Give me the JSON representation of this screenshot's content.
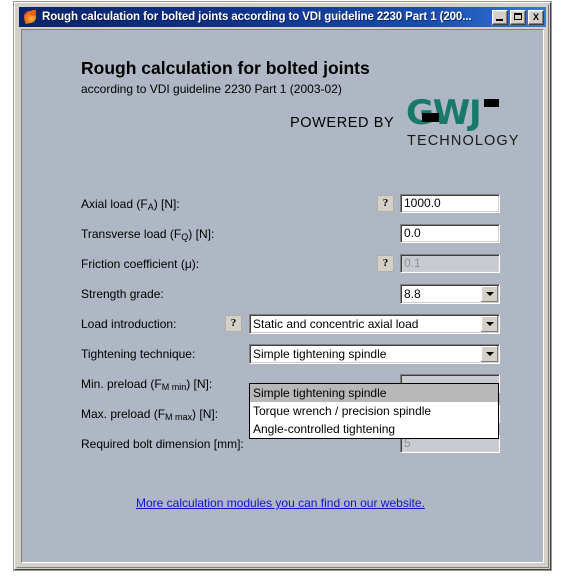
{
  "window": {
    "title": "Rough calculation for bolted joints according to VDI guideline 2230 Part 1 (200...",
    "icon": "firefox-icon",
    "minimize_label": "_",
    "maximize_label": "□",
    "close_label": "X"
  },
  "header": {
    "heading": "Rough calculation for bolted joints",
    "subheading": "according to VDI guideline 2230 Part 1 (2003-02)",
    "powered_by": "POWERED BY",
    "logo_mark": "GWJ",
    "logo_word": "TECHNOLOGY",
    "logo_color": "#18796b"
  },
  "form": {
    "help_glyph": "?",
    "rows": [
      {
        "label_main": "Axial load (F",
        "label_sub": "A",
        "label_tail": ") [N]:",
        "has_help": true,
        "control": "text",
        "value": "1000.0",
        "disabled": false
      },
      {
        "label_main": "Transverse load (F",
        "label_sub": "Q",
        "label_tail": ") [N]:",
        "has_help": false,
        "control": "text",
        "value": "0.0",
        "disabled": false
      },
      {
        "label_main": "Friction coefficient (μ):",
        "label_sub": "",
        "label_tail": "",
        "has_help": true,
        "control": "text",
        "value": "0.1",
        "disabled": true
      },
      {
        "label_main": "Strength grade:",
        "label_sub": "",
        "label_tail": "",
        "has_help": false,
        "control": "combo-short",
        "value": "8.8",
        "disabled": false
      },
      {
        "label_main": "Load introduction:",
        "label_sub": "",
        "label_tail": "",
        "has_help": true,
        "control": "combo-long",
        "value": "Static and concentric axial load",
        "disabled": false
      },
      {
        "label_main": "Tightening technique:",
        "label_sub": "",
        "label_tail": "",
        "has_help": false,
        "control": "combo-long-open",
        "value": "Simple tightening spindle",
        "disabled": false
      },
      {
        "label_main": "Min. preload (F",
        "label_sub": "M min",
        "label_tail": ") [N]:",
        "has_help": false,
        "control": "text-hidden",
        "value": "",
        "disabled": true
      },
      {
        "label_main": "Max. preload (F",
        "label_sub": "M max",
        "label_tail": ") [N]:",
        "has_help": false,
        "control": "text-hidden",
        "value": "",
        "disabled": true
      },
      {
        "label_main": "Required bolt dimension [mm]:",
        "label_sub": "",
        "label_tail": "",
        "has_help": false,
        "control": "text",
        "value": "5",
        "disabled": true
      }
    ]
  },
  "dropdown": {
    "open": true,
    "options": [
      "Simple tightening spindle",
      "Torque wrench / precision spindle",
      "Angle-controlled tightening"
    ],
    "selected_index": 0
  },
  "footer": {
    "link_text": "More calculation modules you can find on our website."
  }
}
